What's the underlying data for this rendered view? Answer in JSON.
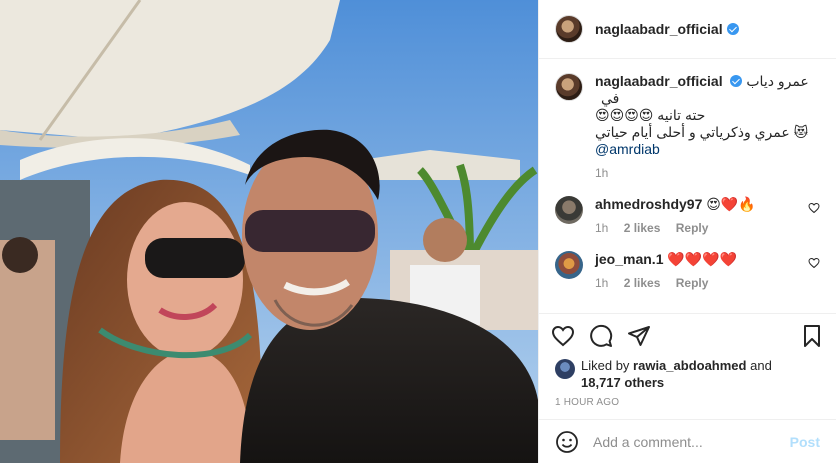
{
  "post": {
    "author": "naglaabadr_official",
    "caption_line1": "عمرو دياب في",
    "caption_line2": "حته تانيه 😍😍😍😍",
    "caption_line3": "😻 عمري وذكرياتي و أحلى أيام حياتي",
    "caption_mention": "@amrdiab",
    "caption_time": "1h"
  },
  "comments": [
    {
      "user": "ahmedroshdy97",
      "text": "😍❤️🔥",
      "time": "1h",
      "likes": "2 likes",
      "reply": "Reply"
    },
    {
      "user": "jeo_man.1",
      "text": "❤️❤️❤️❤️",
      "time": "1h",
      "likes": "2 likes",
      "reply": "Reply"
    }
  ],
  "likes": {
    "prefix": "Liked by",
    "user": "rawia_abdoahmed",
    "and": "and",
    "others": "18,717 others"
  },
  "timestamp": "1 HOUR AGO",
  "add_comment": {
    "placeholder": "Add a comment...",
    "post_label": "Post"
  },
  "icons": {
    "like": "heart-icon",
    "comment": "comment-icon",
    "share": "share-icon",
    "save": "bookmark-icon",
    "emoji": "emoji-icon",
    "verified": "verified-badge-icon"
  },
  "colors": {
    "verified": "#3897f0",
    "mention": "#00376b",
    "post_button": "#b2dffc",
    "muted": "#8e8e8e"
  }
}
